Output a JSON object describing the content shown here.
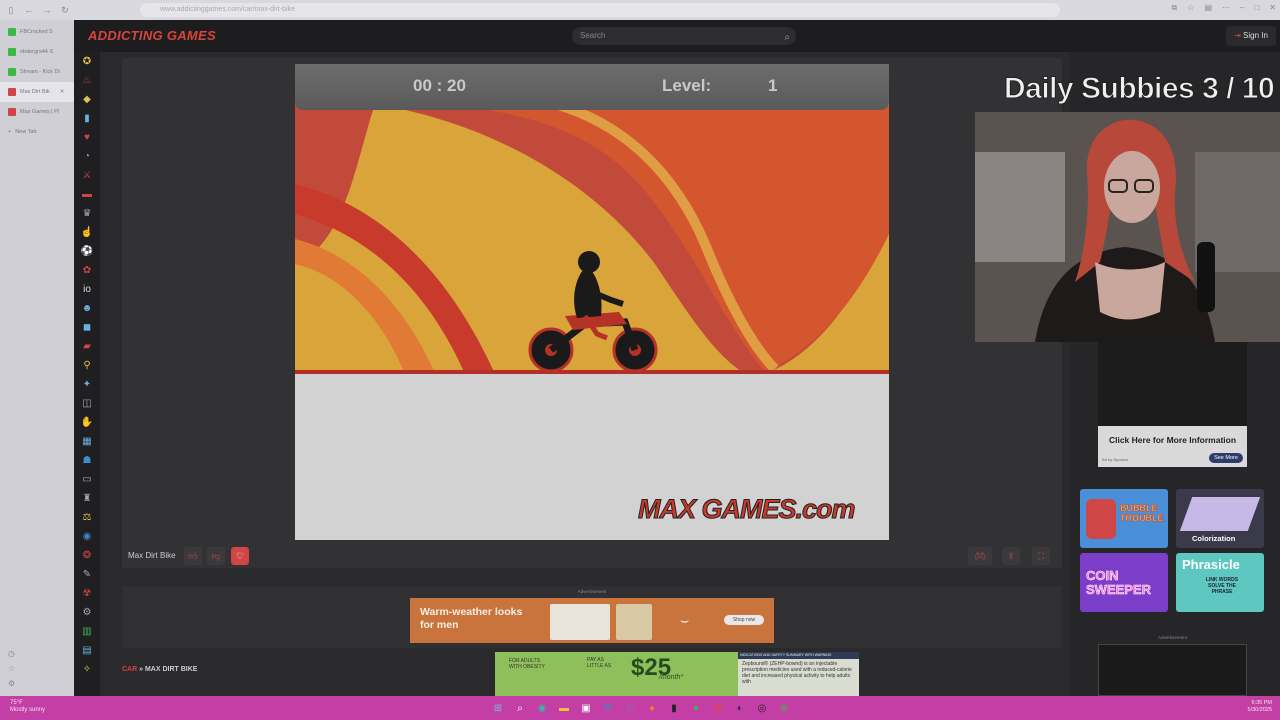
{
  "browser": {
    "url": "www.addictinggames.com/car/max-dirt-bike",
    "tabs": [
      {
        "label": "FBCrocked S",
        "color": "#3cb84a"
      },
      {
        "label": "obdergrs44 S",
        "color": "#3cb84a"
      },
      {
        "label": "Stream - Kick Di",
        "color": "#3cb84a"
      },
      {
        "label": "Max Dirt Bik",
        "color": "#d04545"
      },
      {
        "label": "Max Games | Pl",
        "color": "#d04545"
      },
      {
        "label": "New Tab",
        "color": "#999999"
      }
    ]
  },
  "site": {
    "logo": "ADDICTING GAMES",
    "search_placeholder": "Search",
    "signin": "Sign In"
  },
  "game": {
    "timer": "00 : 20",
    "level_label": "Level:",
    "level_value": "1",
    "watermark": "MAX GAMES.com",
    "title": "Max Dirt Bike"
  },
  "ads": {
    "label": "Advertisement",
    "amazon_text": "Warm-weather looks for men",
    "amazon_shop": "Shop now",
    "zep_adults": "FOR ADULTS WITH OBESITY",
    "zep_pay": "PAY AS LITTLE AS",
    "zep_price": "$25",
    "zep_month": "/month*",
    "zep_header": "INDICATIONS AND SAFETY SUMMARY WITH WARNING",
    "zep_body": "Zepbound® (ZEHP-bownd) is an injectable prescription medicine used with a reduced-calorie diet and increased physical activity to help adults with"
  },
  "breadcrumb": {
    "category": "CAR",
    "sep": " » ",
    "page": "MAX DIRT BIKE"
  },
  "stream": {
    "overlay": "Daily Subbies 3 / 10"
  },
  "sponsor": {
    "title": "Click Here for More Information",
    "by": "Ad by Sponsor",
    "more": "See More"
  },
  "thumbs": [
    {
      "label": "BUBBLE TROUBLE"
    },
    {
      "label": "Colorization"
    },
    {
      "label": "COIN SWEEPER"
    },
    {
      "label": "Phrasicle"
    }
  ],
  "phrasicle_sub": "LINK WORDS SOLVE THE PHRASE",
  "taskbar": {
    "temp": "75°F",
    "weather": "Mostly sunny",
    "time": "6:35 PM",
    "date": "5/30/2025"
  },
  "colors": {
    "brand_red": "#d8453c",
    "taskbar": "#c33fa5"
  }
}
